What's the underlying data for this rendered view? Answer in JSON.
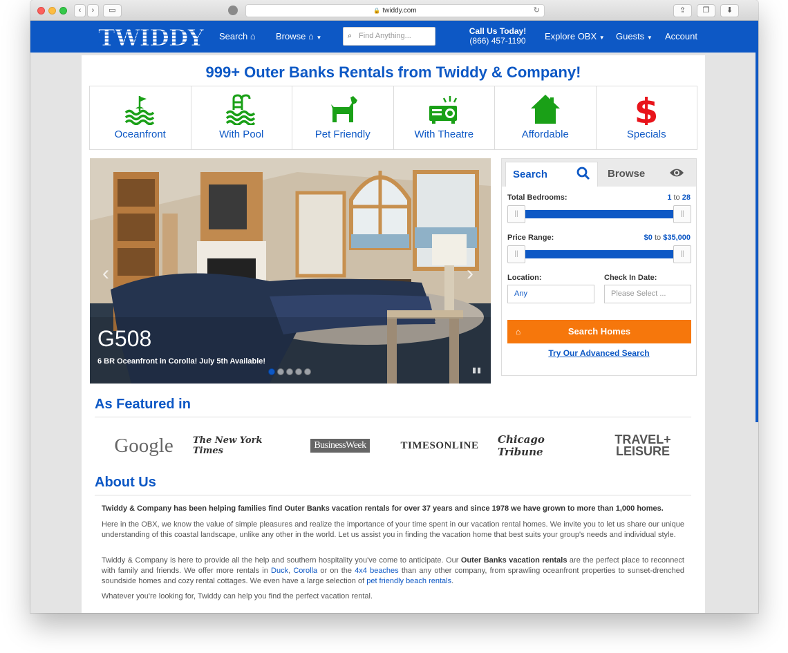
{
  "browser": {
    "url": "twiddy.com"
  },
  "nav": {
    "logo_text": "TWIDDY",
    "search_label": "Search",
    "browse_label": "Browse",
    "find_placeholder": "Find Anything...",
    "call_title": "Call Us Today!",
    "call_phone": "(866) 457-1190",
    "explore_label": "Explore OBX",
    "guests_label": "Guests",
    "account_label": "Account"
  },
  "headline": "999+ Outer Banks Rentals from Twiddy & Company!",
  "categories": [
    {
      "label": "Oceanfront",
      "icon": "oceanfront-flag-waves-icon",
      "color": "#1aa017"
    },
    {
      "label": "With Pool",
      "icon": "pool-ladder-icon",
      "color": "#1aa017"
    },
    {
      "label": "Pet Friendly",
      "icon": "dog-icon",
      "color": "#1aa017"
    },
    {
      "label": "With Theatre",
      "icon": "projector-icon",
      "color": "#1aa017"
    },
    {
      "label": "Affordable",
      "icon": "house-icon",
      "color": "#1aa017"
    },
    {
      "label": "Specials",
      "icon": "dollar-icon",
      "color": "#e8141b"
    }
  ],
  "slide": {
    "title": "G508",
    "subtitle": "6 BR Oceanfront in Corolla! July 5th Available!",
    "dot_count": 5,
    "active_dot": 1
  },
  "search_panel": {
    "tab_search": "Search",
    "tab_browse": "Browse",
    "bedrooms_label": "Total Bedrooms:",
    "bedrooms_min": "1",
    "bedrooms_max": "28",
    "price_label": "Price Range:",
    "price_min": "$0",
    "price_max": "$35,000",
    "range_sep": "to",
    "location_label": "Location:",
    "location_value": "Any",
    "checkin_label": "Check In Date:",
    "checkin_placeholder": "Please Select ...",
    "search_button": "Search Homes",
    "advanced_link": "Try Our Advanced Search"
  },
  "featured": {
    "heading": "As Featured in",
    "logos": [
      "Google",
      "The New York Times",
      "BusinessWeek",
      "TIMESONLINE",
      "Chicago Tribune",
      "TRAVEL+ LEISURE"
    ]
  },
  "about": {
    "heading": "About Us",
    "p1": "Twiddy & Company has been helping families find Outer Banks vacation rentals for over 37 years and since 1978 we have grown to more than 1,000 homes.",
    "p2": "Here in the OBX, we know the value of simple pleasures and realize the importance of your time spent in our vacation rental homes. We invite you to let us share our unique understanding of this coastal landscape, unlike any other in the world. Let us assist you in finding the vacation home that best suits your group's needs and individual style.",
    "p3_a": "Twiddy & Company is here to provide all the help and southern hospitality you've come to anticipate. Our ",
    "p3_b": "Outer Banks vacation rentals",
    "p3_c": " are the perfect place to reconnect with family and friends. We offer more rentals in ",
    "p3_link1": "Duck",
    "p3_d": ", ",
    "p3_link2": "Corolla",
    "p3_e": " or on the ",
    "p3_link3": "4x4 beaches",
    "p3_f": " than any other company, from sprawling oceanfront properties to sunset-drenched soundside homes and cozy rental cottages. We even have a large selection of ",
    "p3_link4": "pet friendly beach rentals",
    "p3_g": ".",
    "p4": "Whatever you're looking for, Twiddy can help you find the perfect vacation rental."
  },
  "colors": {
    "brand_blue": "#0d58c5",
    "category_green": "#1aa017",
    "specials_red": "#e8141b",
    "search_button": "#f6770c"
  }
}
